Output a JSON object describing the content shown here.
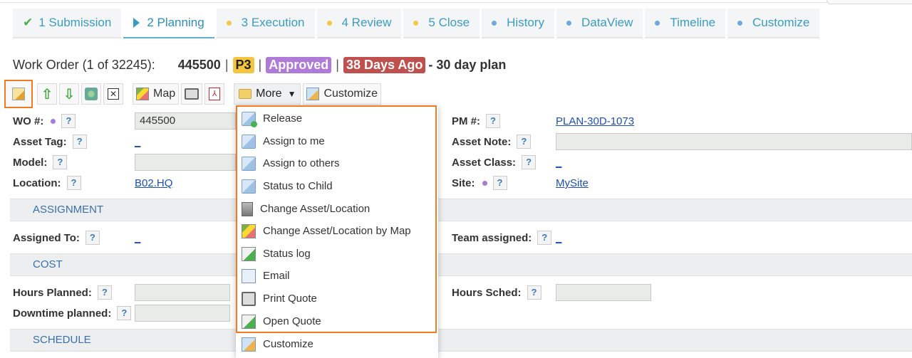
{
  "tabs": [
    {
      "label": "1 Submission",
      "icon": "check-icon",
      "state": "done"
    },
    {
      "label": "2 Planning",
      "icon": "play-icon",
      "state": "active"
    },
    {
      "label": "3 Execution",
      "icon": "yellow-dot",
      "state": "pending"
    },
    {
      "label": "4 Review",
      "icon": "yellow-dot",
      "state": "pending"
    },
    {
      "label": "5 Close",
      "icon": "yellow-dot",
      "state": "pending"
    },
    {
      "label": "History",
      "icon": "blue-dot",
      "state": "info"
    },
    {
      "label": "DataView",
      "icon": "blue-dot",
      "state": "info"
    },
    {
      "label": "Timeline",
      "icon": "blue-dot",
      "state": "info"
    },
    {
      "label": "Customize",
      "icon": "blue-dot",
      "state": "info"
    }
  ],
  "header": {
    "label": "Work Order (1 of 32245):",
    "number": "445500",
    "sep": "|",
    "priority": "P3",
    "status": "Approved",
    "age": "38 Days Ago",
    "plan": "- 30 day plan"
  },
  "toolbar": {
    "map_label": "Map",
    "more_label": "More",
    "customize_label": "Customize"
  },
  "form": {
    "wo_label": "WO #:",
    "wo_value": "445500",
    "asset_tag_label": "Asset Tag:",
    "model_label": "Model:",
    "location_label": "Location:",
    "location_value": "B02.HQ",
    "pm_label": "PM #:",
    "pm_value": "PLAN-30D-1073",
    "asset_note_label": "Asset Note:",
    "asset_class_label": "Asset Class:",
    "site_label": "Site:",
    "site_value": "MySite",
    "help": "?",
    "empty_link": "_"
  },
  "sections": {
    "assignment": "ASSIGNMENT",
    "cost": "COST",
    "schedule": "SCHEDULE"
  },
  "assignment": {
    "assigned_to_label": "Assigned To:",
    "team_label": "Team assigned:"
  },
  "cost": {
    "hours_planned_label": "Hours Planned:",
    "downtime_label": "Downtime planned:",
    "hours_sched_label": "Hours Sched:"
  },
  "menu": {
    "items": [
      {
        "label": "Release",
        "icon": "release-icon"
      },
      {
        "label": "Assign to me",
        "icon": "assign-me-icon"
      },
      {
        "label": "Assign to others",
        "icon": "assign-others-icon"
      },
      {
        "label": "Status to Child",
        "icon": "status-child-icon"
      },
      {
        "label": "Change Asset/Location",
        "icon": "building-icon"
      },
      {
        "label": "Change Asset/Location by Map",
        "icon": "map-icon"
      },
      {
        "label": "Status log",
        "icon": "status-log-icon"
      },
      {
        "label": "Email",
        "icon": "email-icon"
      },
      {
        "label": "Print Quote",
        "icon": "printer-icon"
      },
      {
        "label": "Open Quote",
        "icon": "open-quote-icon"
      },
      {
        "label": "Customize",
        "icon": "customize-icon"
      }
    ]
  },
  "colors": {
    "accent": "#3b9cc4",
    "highlight": "#ef7b22",
    "p3": "#f5c542",
    "approved": "#b07ad8",
    "overdue": "#c0504d",
    "link": "#1d4fb3"
  }
}
